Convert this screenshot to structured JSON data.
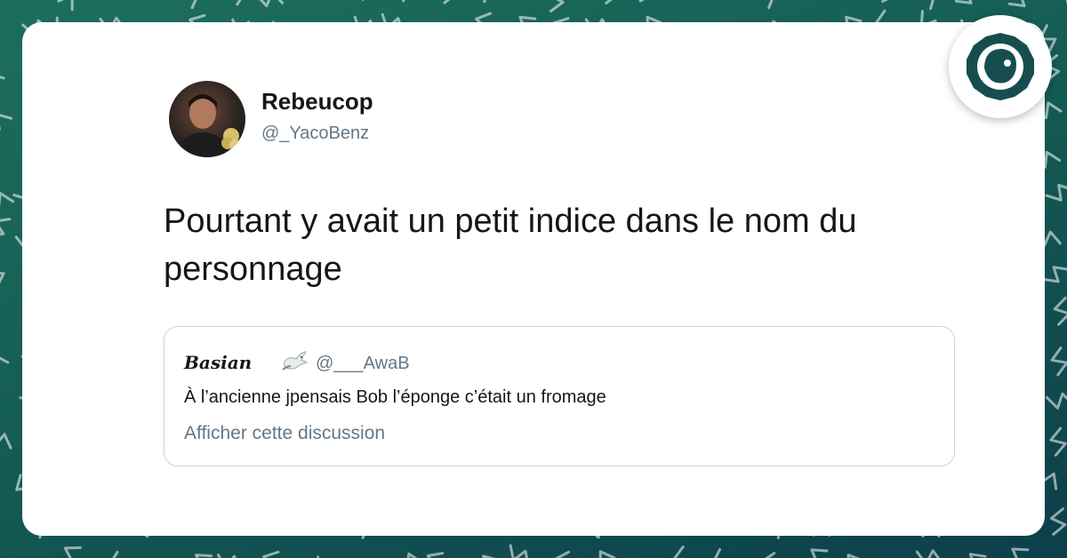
{
  "tweet": {
    "author_name": "Rebeucop",
    "author_handle": "@_YacoBenz",
    "text": "Pourtant y avait un petit indice dans le nom du personnage"
  },
  "quoted_tweet": {
    "author_name": "Basian",
    "author_emoji": "dove-icon",
    "author_handle": "@___AwaB",
    "text": "À l’ancienne jpensais Bob l’éponge c’était un fromage",
    "show_thread_link": "Afficher cette discussion"
  },
  "brand": {
    "logo_icon": "brand-logo-icon",
    "logo_color": "#164e4f"
  },
  "colors": {
    "background": "#155d55",
    "card": "#ffffff",
    "primary_text": "#14171a",
    "secondary_text": "#657786",
    "border": "#c9d3dc"
  }
}
